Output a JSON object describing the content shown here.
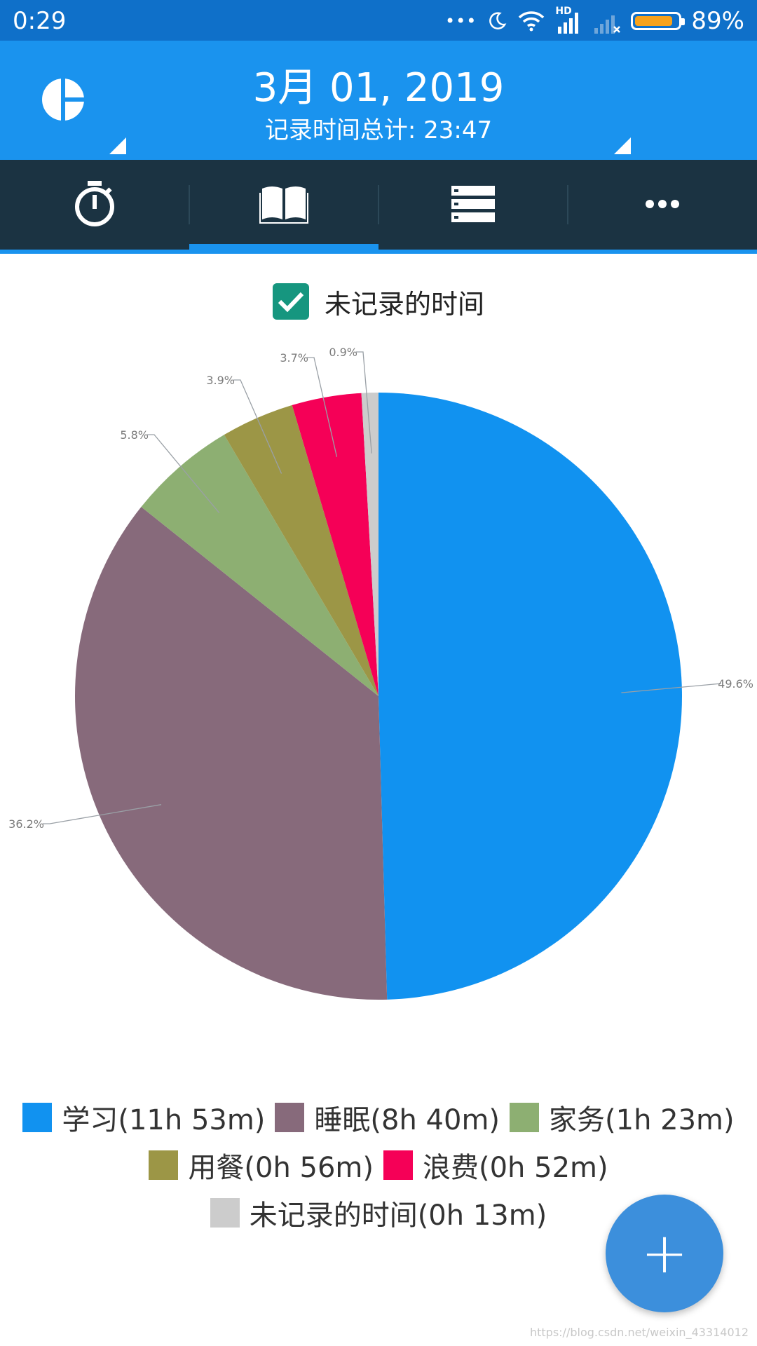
{
  "status_bar": {
    "time": "0:29",
    "dots": "•••",
    "hd": "HD",
    "battery_percent": "89%",
    "battery_level": 0.89
  },
  "header": {
    "date": "3月 01, 2019",
    "total_time": "记录时间总计: 23:47"
  },
  "tabs": [
    {
      "icon": "stopwatch-icon"
    },
    {
      "icon": "book-icon",
      "selected": true
    },
    {
      "icon": "list-icon"
    },
    {
      "icon": "more-icon"
    }
  ],
  "filter": {
    "checkbox_label": "未记录的时间",
    "checked": true
  },
  "chart_data": {
    "type": "pie",
    "categories": [
      "学习",
      "睡眠",
      "家务",
      "用餐",
      "浪费",
      "未记录的时间"
    ],
    "values": [
      49.6,
      36.2,
      5.8,
      3.9,
      3.7,
      0.9
    ],
    "labels": [
      "49.6%",
      "36.2%",
      "5.8%",
      "3.9%",
      "3.7%",
      "0.9%"
    ],
    "colors": [
      "#1192f0",
      "#876a7b",
      "#8daf72",
      "#9c9646",
      "#f50057",
      "#cccccc"
    ],
    "legend": [
      "学习(11h 53m)",
      "睡眠(8h 40m)",
      "家务(1h 23m)",
      "用餐(0h 56m)",
      "浪费(0h 52m)",
      "未记录的时间(0h 13m)"
    ],
    "legend_placement": "bottom"
  },
  "fab": {
    "label": "+"
  },
  "watermark": "https://blog.csdn.net/weixin_43314012"
}
